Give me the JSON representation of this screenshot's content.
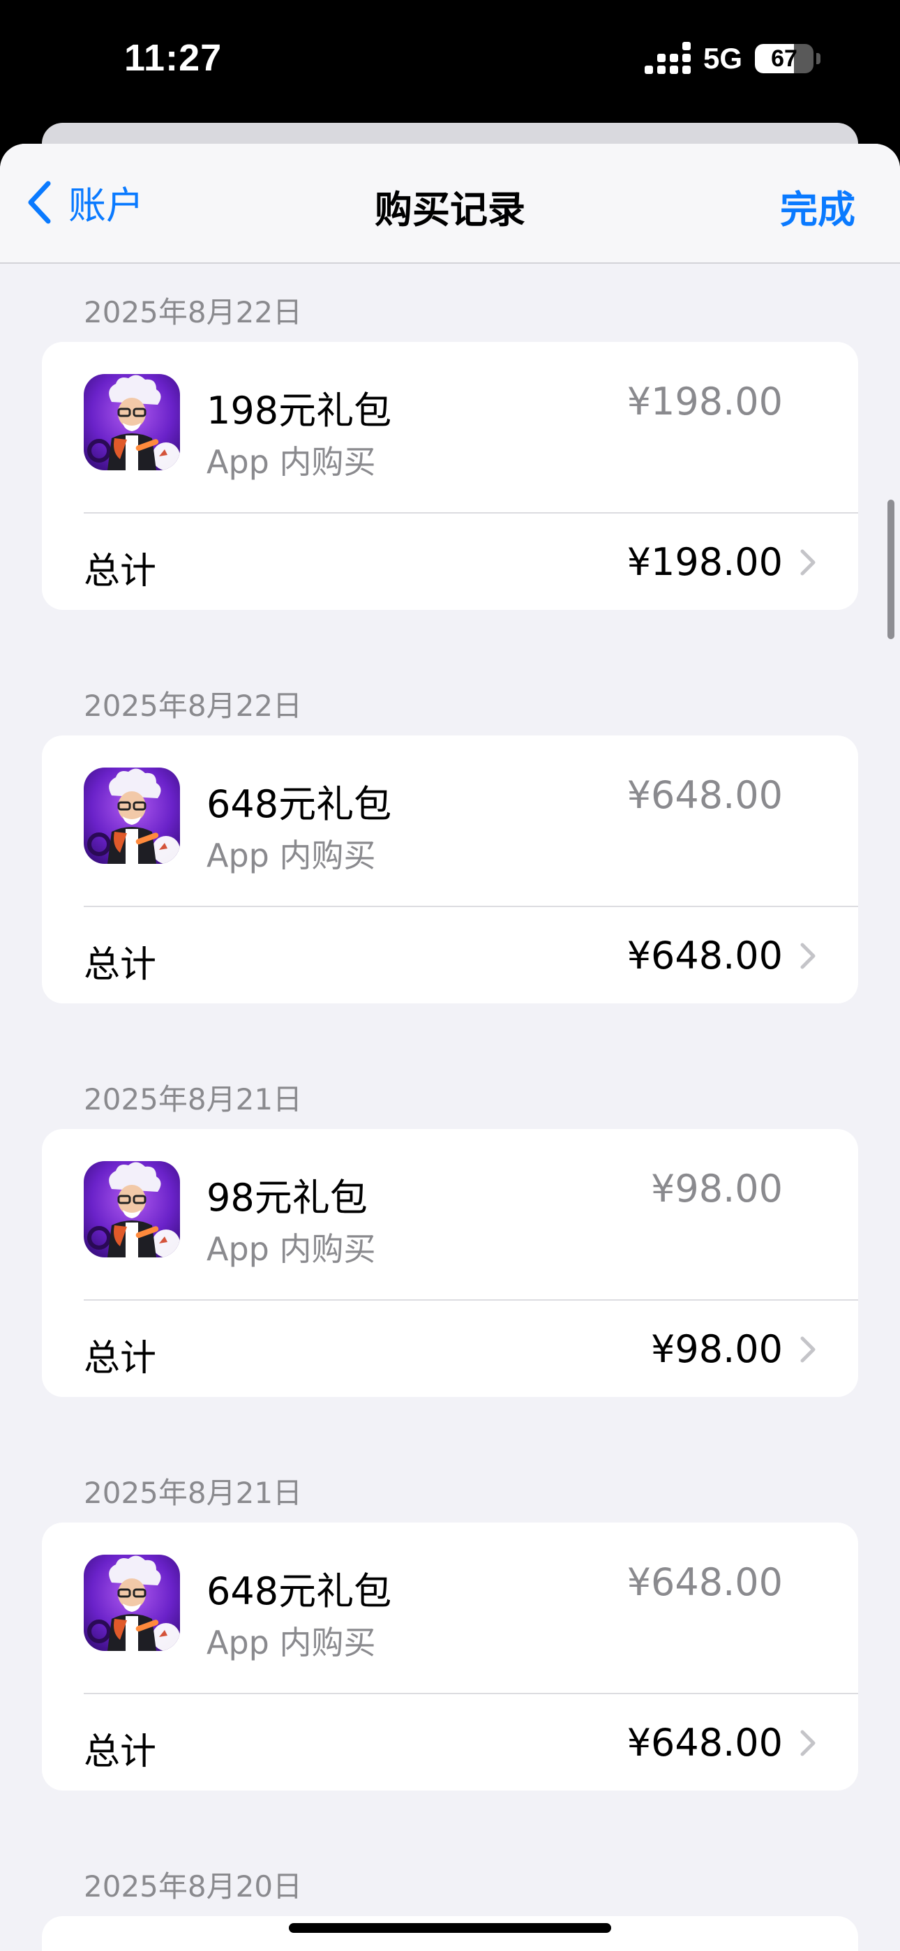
{
  "status_bar": {
    "time": "11:27",
    "network": "5G",
    "battery": 67
  },
  "nav": {
    "back_label": "账户",
    "title": "购买记录",
    "done_label": "完成"
  },
  "icons": {
    "back": "chevron-left-icon",
    "disclosure": "chevron-right-icon",
    "app": "game-app-icon"
  },
  "colors": {
    "accent": "#0a7aff",
    "secondary_text": "#8a8a8e",
    "background": "#f2f2f7"
  },
  "purchases": [
    {
      "date": "2025年8月22日",
      "item_name": "198元礼包",
      "item_type": "App 内购买",
      "item_price": "¥198.00",
      "total_label": "总计",
      "total_value": "¥198.00"
    },
    {
      "date": "2025年8月22日",
      "item_name": "648元礼包",
      "item_type": "App 内购买",
      "item_price": "¥648.00",
      "total_label": "总计",
      "total_value": "¥648.00"
    },
    {
      "date": "2025年8月21日",
      "item_name": "98元礼包",
      "item_type": "App 内购买",
      "item_price": "¥98.00",
      "total_label": "总计",
      "total_value": "¥98.00"
    },
    {
      "date": "2025年8月21日",
      "item_name": "648元礼包",
      "item_type": "App 内购买",
      "item_price": "¥648.00",
      "total_label": "总计",
      "total_value": "¥648.00"
    }
  ],
  "next_section_date": "2025年8月20日"
}
